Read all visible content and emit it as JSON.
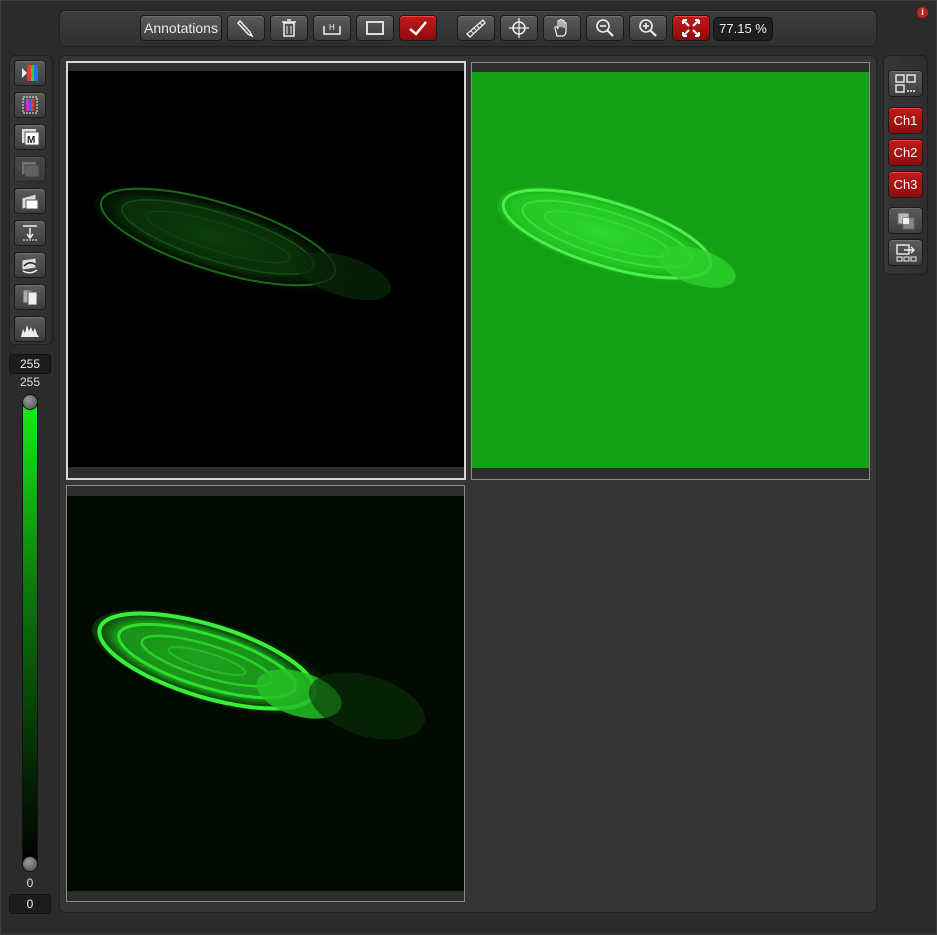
{
  "toolbar": {
    "annotations_label": "Annotations",
    "zoom_level": "77.15 %",
    "icons": [
      "pen-icon",
      "trash-icon",
      "measure-icon",
      "rectangle-icon",
      "check-icon",
      "ruler-icon",
      "crosshair-icon",
      "hand-icon",
      "zoom-out-icon",
      "zoom-in-icon",
      "fit-screen-icon"
    ]
  },
  "left_tools": {
    "icons": [
      "lut-color-icon",
      "lut-palette-icon",
      "max-projection-icon",
      "stack-icon",
      "slice-icon",
      "z-step-icon",
      "rotate-icon",
      "copy-icon",
      "histogram-icon"
    ]
  },
  "lut": {
    "max_value": "255",
    "max_label": "255",
    "min_label": "0",
    "min_value": "0",
    "max_level": 1.0,
    "min_level": 0.0,
    "color": "#18ee18"
  },
  "right_tools": {
    "layout_icon": "grid-layout-icon",
    "channels": [
      "Ch1",
      "Ch2",
      "Ch3"
    ],
    "overlay_icon": "overlay-icon",
    "export_icon": "export-icon"
  },
  "colors": {
    "accent_red": "#b01414",
    "channel_green": "#14b414"
  }
}
